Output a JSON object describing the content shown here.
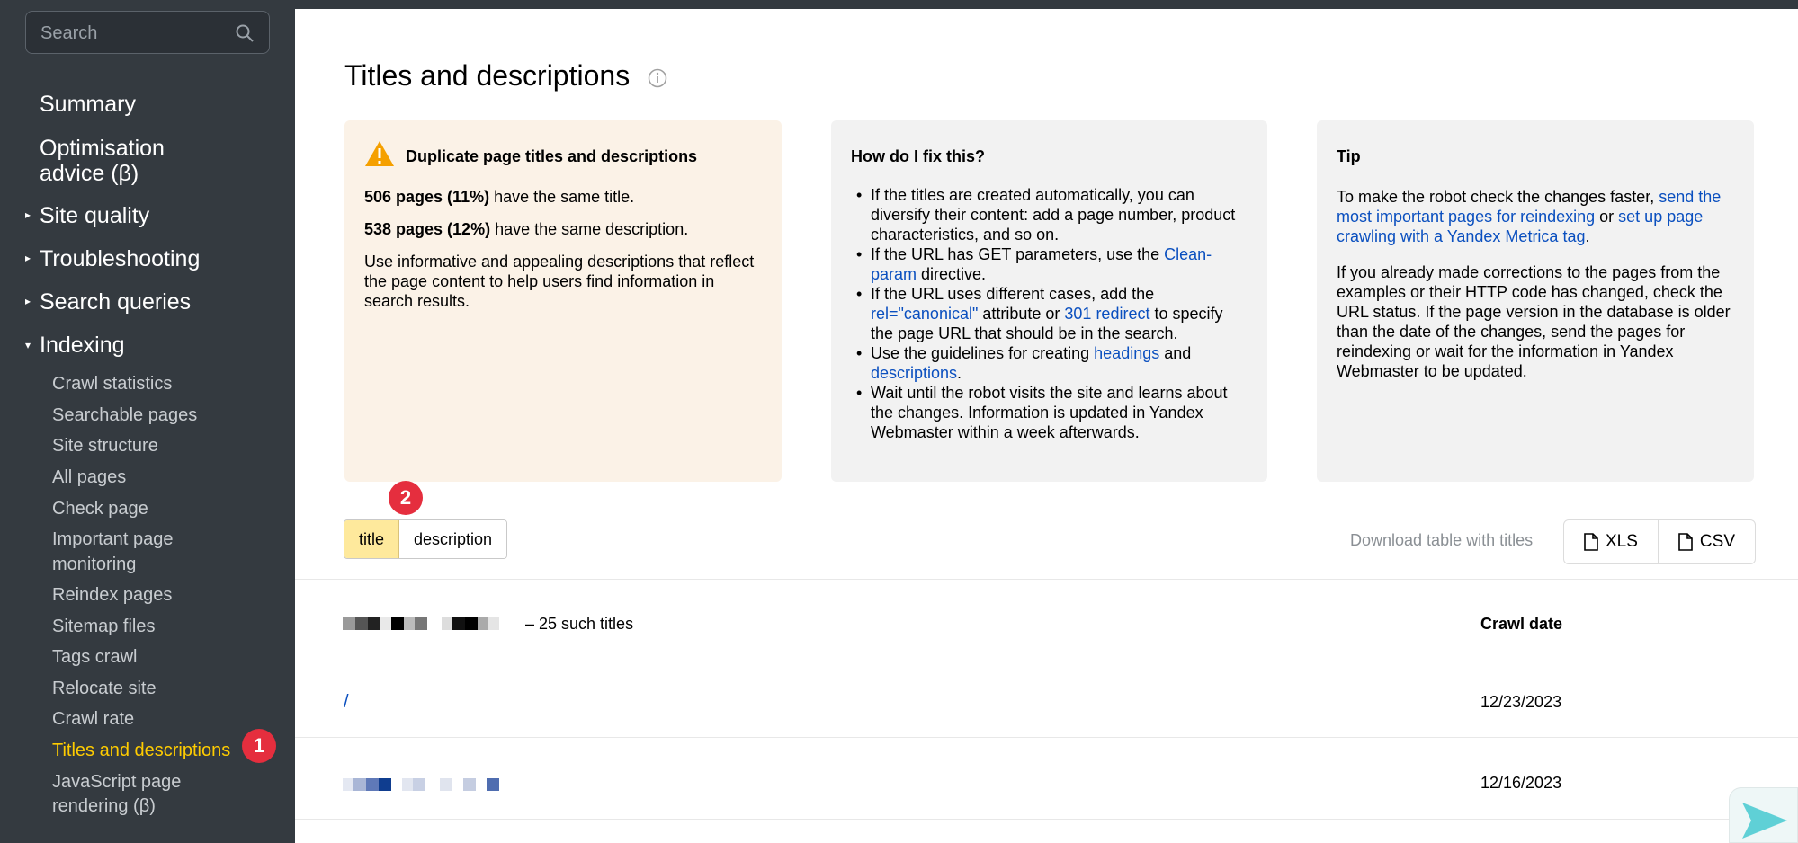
{
  "search": {
    "placeholder": "Search"
  },
  "nav": {
    "summary": "Summary",
    "optimisation_line1": "Optimisation",
    "optimisation_line2": "advice (β)",
    "site_quality": "Site quality",
    "troubleshooting": "Troubleshooting",
    "search_queries": "Search queries",
    "indexing": "Indexing",
    "sub": [
      "Crawl statistics",
      "Searchable pages",
      "Site structure",
      "All pages",
      "Check page",
      "Important page",
      "monitoring",
      "Reindex pages",
      "Sitemap files",
      "Tags crawl",
      "Relocate site",
      "Crawl rate",
      "Titles and descriptions",
      "JavaScript page",
      "rendering (β)"
    ]
  },
  "badges": {
    "one": "1",
    "two": "2"
  },
  "page": {
    "title": "Titles and descriptions"
  },
  "dup_card": {
    "title": "Duplicate page titles and descriptions",
    "titles_bold": "506 pages (11%)",
    "titles_rest": " have the same title.",
    "desc_bold": "538 pages (12%)",
    "desc_rest": " have the same description.",
    "advice": "Use informative and appealing descriptions that reflect the page content to help users find information in search results."
  },
  "fix_card": {
    "title": "How do I fix this?",
    "b1": "If the titles are created automatically, you can diversify their content: add a page number, product characteristics, and so on.",
    "b2_pre": "If the URL has GET parameters, use the ",
    "b2_link": "Clean-param",
    "b2_post": " directive.",
    "b3_pre": "If the URL uses different cases, add the ",
    "b3_link1": "rel=\"canonical\"",
    "b3_mid": " attribute or ",
    "b3_link2": "301 redirect",
    "b3_post": " to specify the page URL that should be in the search.",
    "b4_pre": "Use the guidelines for creating ",
    "b4_link1": "headings",
    "b4_mid": " and ",
    "b4_link2": "descriptions",
    "b4_post": ".",
    "b5": "Wait until the robot visits the site and learns about the changes. Information is updated in Yandex Webmaster within a week afterwards."
  },
  "tip_card": {
    "title": "Tip",
    "p1_pre": "To make the robot check the changes faster, ",
    "p1_link1": "send the most important pages for reindexing",
    "p1_mid": " or ",
    "p1_link2": "set up page crawling with a Yandex Metrica tag",
    "p1_post": ".",
    "p2": "If you already made corrections to the pages from the examples or their HTTP code has changed, check the URL status. If the page version in the database is older than the date of the changes, send the pages for reindexing or wait for the information in Yandex Webmaster to be updated."
  },
  "toggle": {
    "title": "title",
    "description": "description"
  },
  "download": {
    "label": "Download table with titles",
    "xls": "XLS",
    "csv": "CSV"
  },
  "table": {
    "group_suffix": "– 25 such titles",
    "crawl_date_header": "Crawl date",
    "rows": [
      {
        "url": "/",
        "date": "12/23/2023"
      },
      {
        "url": "",
        "date": "12/16/2023"
      }
    ]
  },
  "colors": {
    "accent": "#ffcc00",
    "link": "#0a4fbf",
    "badge": "#e52e3e",
    "sidebar": "#343a40"
  }
}
